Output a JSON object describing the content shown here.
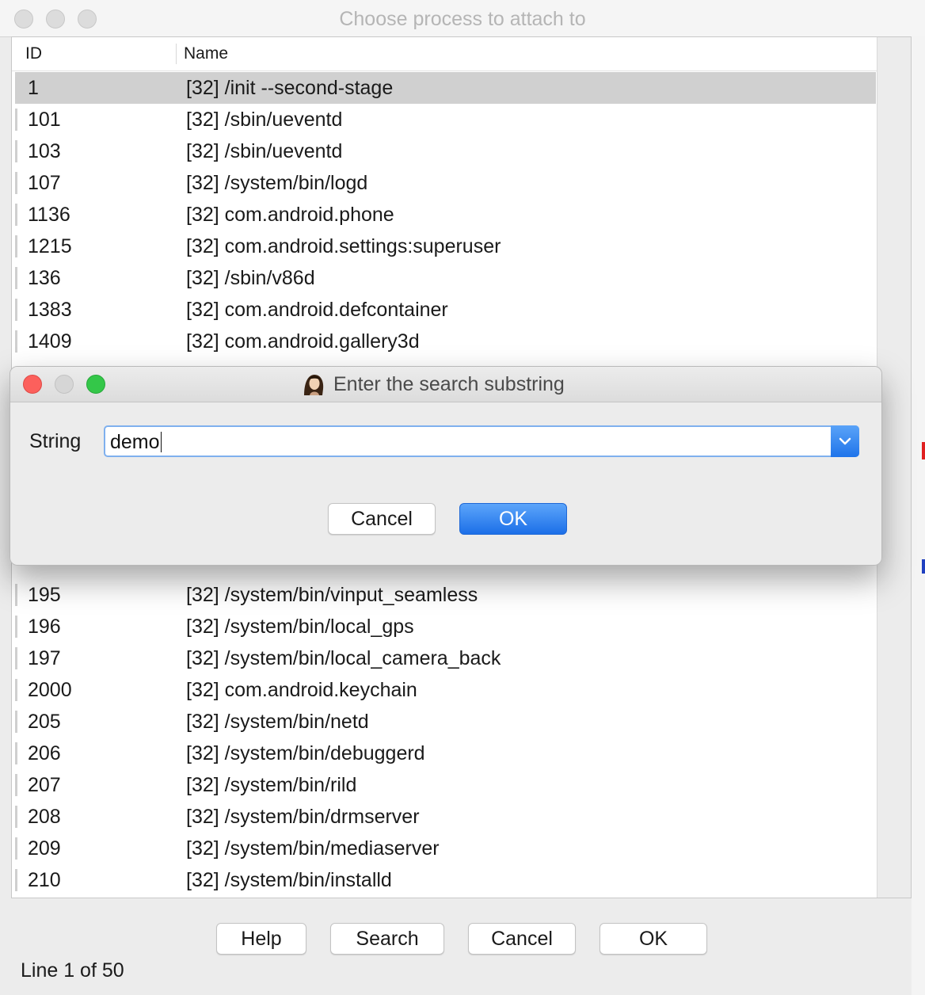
{
  "window": {
    "title": "Choose process to attach to",
    "columns": {
      "id": "ID",
      "name": "Name"
    },
    "rows_top": [
      {
        "id": "1",
        "name": "[32] /init --second-stage",
        "selected": true
      },
      {
        "id": "101",
        "name": "[32] /sbin/ueventd"
      },
      {
        "id": "103",
        "name": "[32] /sbin/ueventd"
      },
      {
        "id": "107",
        "name": "[32] /system/bin/logd"
      },
      {
        "id": "1136",
        "name": "[32] com.android.phone"
      },
      {
        "id": "1215",
        "name": "[32] com.android.settings:superuser"
      },
      {
        "id": "136",
        "name": "[32] /sbin/v86d"
      },
      {
        "id": "1383",
        "name": "[32] com.android.defcontainer"
      },
      {
        "id": "1409",
        "name": "[32] com.android.gallery3d"
      }
    ],
    "rows_bottom": [
      {
        "id": "195",
        "name": "[32] /system/bin/vinput_seamless"
      },
      {
        "id": "196",
        "name": "[32] /system/bin/local_gps"
      },
      {
        "id": "197",
        "name": "[32] /system/bin/local_camera_back"
      },
      {
        "id": "2000",
        "name": "[32] com.android.keychain"
      },
      {
        "id": "205",
        "name": "[32] /system/bin/netd"
      },
      {
        "id": "206",
        "name": "[32] /system/bin/debuggerd"
      },
      {
        "id": "207",
        "name": "[32] /system/bin/rild"
      },
      {
        "id": "208",
        "name": "[32] /system/bin/drmserver"
      },
      {
        "id": "209",
        "name": "[32] /system/bin/mediaserver"
      },
      {
        "id": "210",
        "name": "[32] /system/bin/installd"
      }
    ],
    "buttons": {
      "help": "Help",
      "search": "Search",
      "cancel": "Cancel",
      "ok": "OK"
    },
    "status": "Line 1 of 50"
  },
  "dialog": {
    "title": "Enter the search substring",
    "string_label": "String",
    "string_value": "demo",
    "cancel_label": "Cancel",
    "ok_label": "OK"
  },
  "colors": {
    "accent": "#1f74ea",
    "selected_row": "#d0d0d0",
    "close": "#fc605c",
    "zoom": "#34c749"
  }
}
